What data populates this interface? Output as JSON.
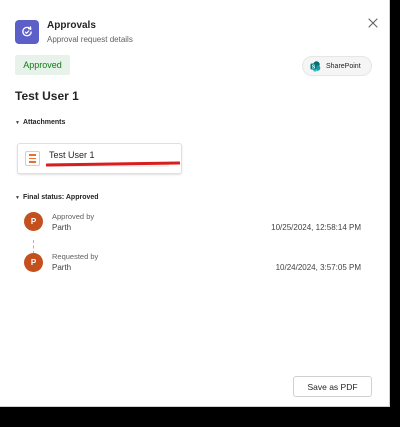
{
  "header": {
    "title": "Approvals",
    "subtitle": "Approval request details",
    "app_icon": "approvals-refresh-icon",
    "close_icon": "close-icon"
  },
  "status": {
    "label": "Approved",
    "color": "#107c10",
    "background": "#e6f2ea"
  },
  "sharepoint": {
    "label": "SharePoint",
    "icon": "sharepoint-icon",
    "icon_color": "#038387"
  },
  "request": {
    "title": "Test User 1"
  },
  "attachments": {
    "header": "Attachments",
    "items": [
      {
        "name": "Test User 1",
        "icon": "form-file-icon"
      }
    ]
  },
  "final_status": {
    "header": "Final status: Approved",
    "entries": [
      {
        "label": "Approved by",
        "name": "Parth",
        "initial": "P",
        "time": "10/25/2024, 12:58:14 PM"
      },
      {
        "label": "Requested by",
        "name": "Parth",
        "initial": "P",
        "time": "10/24/2024, 3:57:05 PM"
      }
    ],
    "avatar_color": "#c4501e"
  },
  "footer": {
    "save_pdf_label": "Save as PDF"
  },
  "accent_color": "#5b5fc7"
}
